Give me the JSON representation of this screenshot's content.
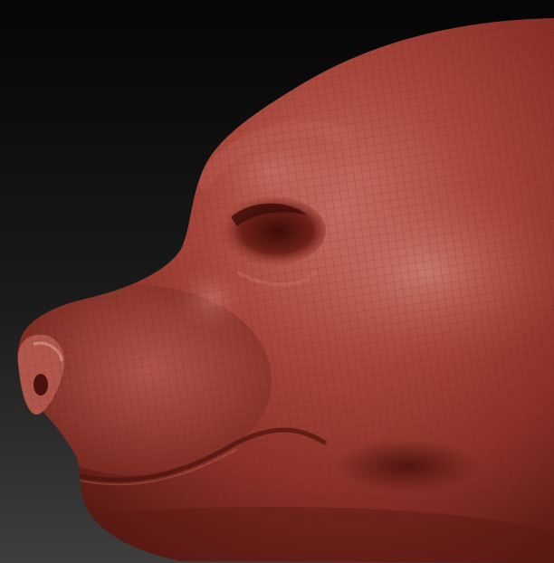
{
  "scene": {
    "subject": "head-sculpt",
    "material": "red-wax-matcap",
    "wireframe_overlay": true
  },
  "colors": {
    "background_top": "#000000",
    "background_bottom": "#3d3d3d",
    "skin_base": "#9a3a30",
    "skin_highlight": "#c46a60",
    "skin_shadow": "#5e1a14",
    "wire": "#6b2a24"
  }
}
